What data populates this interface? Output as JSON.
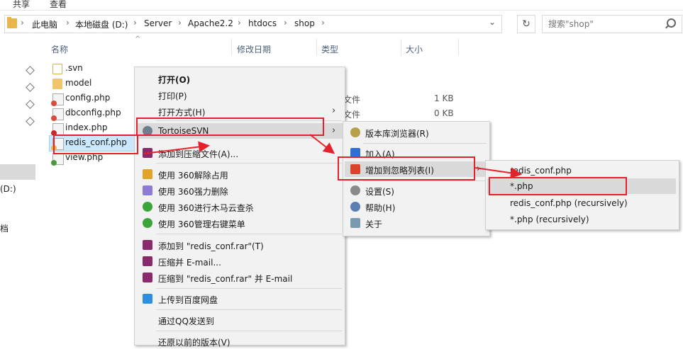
{
  "ribbon": {
    "share": "共享",
    "view": "查看"
  },
  "address": {
    "crumbs": [
      "此电脑",
      "本地磁盘 (D:)",
      "Server",
      "Apache2.2",
      "htdocs",
      "shop"
    ]
  },
  "search": {
    "placeholder": "搜索\"shop\""
  },
  "columns": {
    "name": "名称",
    "modified": "修改日期",
    "type": "类型",
    "size": "大小"
  },
  "nav": {
    "drive": "(D:)",
    "docs": "档"
  },
  "files": [
    {
      "name": ".svn",
      "icon": "folder-icon"
    },
    {
      "name": "model",
      "icon": "folder-icon"
    },
    {
      "name": "config.php",
      "icon": "php-file-icon",
      "type": "文件",
      "size": "1 KB"
    },
    {
      "name": "dbconfig.php",
      "icon": "php-file-icon",
      "type": "文件",
      "size": "0 KB"
    },
    {
      "name": "index.php",
      "icon": "php-file-icon"
    },
    {
      "name": "redis_conf.php",
      "icon": "php-file-icon"
    },
    {
      "name": "view.php",
      "icon": "php-file-icon"
    }
  ],
  "context_menu": {
    "open": "打开(O)",
    "print": "打印(P)",
    "open_with": "打开方式(H)",
    "tortoise": "TortoiseSVN",
    "add_archive": "添加到压缩文件(A)...",
    "unlock360": "使用 360解除占用",
    "force_delete360": "使用 360强力删除",
    "scan360": "使用 360进行木马云查杀",
    "manage360": "使用 360管理右键菜单",
    "add_rar": "添加到 \"redis_conf.rar\"(T)",
    "compress_email": "压缩并 E-mail...",
    "compress_rar_email": "压缩到 \"redis_conf.rar\" 并 E-mail",
    "baidu_upload": "上传到百度网盘",
    "qq_send": "通过QQ发送到",
    "restore": "还原以前的版本(V)"
  },
  "svn_menu": {
    "repo_browser": "版本库浏览器(R)",
    "add": "加入(A)",
    "add_ignore": "增加到忽略列表(I)",
    "settings": "设置(S)",
    "help": "帮助(H)",
    "about": "关于"
  },
  "ignore_menu": {
    "item1": "redis_conf.php",
    "item2": "*.php",
    "item3": "redis_conf.php (recursively)",
    "item4": "*.php (recursively)"
  },
  "colors": {
    "annotation_red": "#e5212b",
    "selection": "#cce8ff",
    "menu_bg": "#f2f2f2"
  }
}
